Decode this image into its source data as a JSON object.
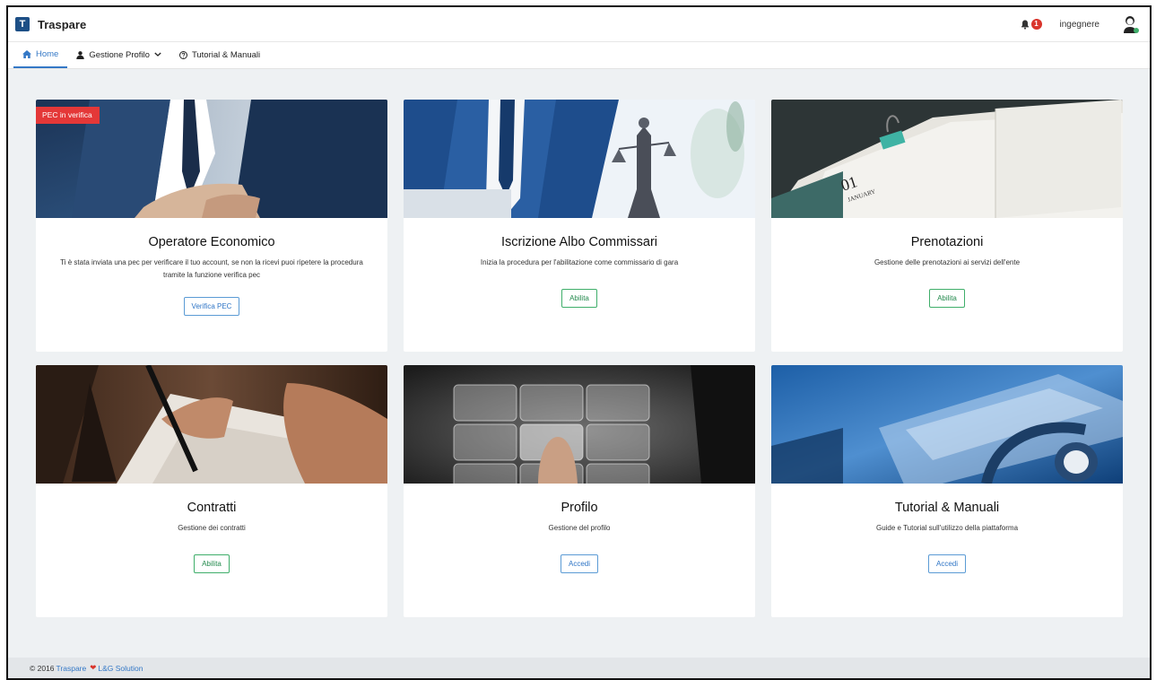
{
  "header": {
    "app_name": "Traspare",
    "notification_count": "1",
    "username": "ingegnere"
  },
  "nav": {
    "home": "Home",
    "profile_menu": "Gestione Profilo",
    "tutorials": "Tutorial & Manuali"
  },
  "cards": [
    {
      "title": "Operatore Economico",
      "desc": "Ti è stata inviata una pec per verificare il tuo account, se non la ricevi puoi ripetere la procedura tramite la funzione verifica pec",
      "button": "Verifica PEC",
      "tag": "PEC in verifica"
    },
    {
      "title": "Iscrizione Albo Commissari",
      "desc": "Inizia la procedura per l'abilitazione come commissario di gara",
      "button": "Abilita"
    },
    {
      "title": "Prenotazioni",
      "desc": "Gestione delle prenotazioni ai servizi dell'ente",
      "button": "Abilita"
    },
    {
      "title": "Contratti",
      "desc": "Gestione dei contratti",
      "button": "Abilita"
    },
    {
      "title": "Profilo",
      "desc": "Gestione del profilo",
      "button": "Accedi"
    },
    {
      "title": "Tutorial & Manuali",
      "desc": "Guide e Tutorial sull'utilizzo della piattaforma",
      "button": "Accedi"
    }
  ],
  "footer": {
    "copyright": "© 2016",
    "brand": "Traspare",
    "company": "L&G Solution"
  },
  "image_text": {
    "calendar_day": "01",
    "calendar_month": "JANUARY"
  },
  "colors": {
    "accent": "#3478c6",
    "success": "#238a4d",
    "danger": "#e43838"
  }
}
